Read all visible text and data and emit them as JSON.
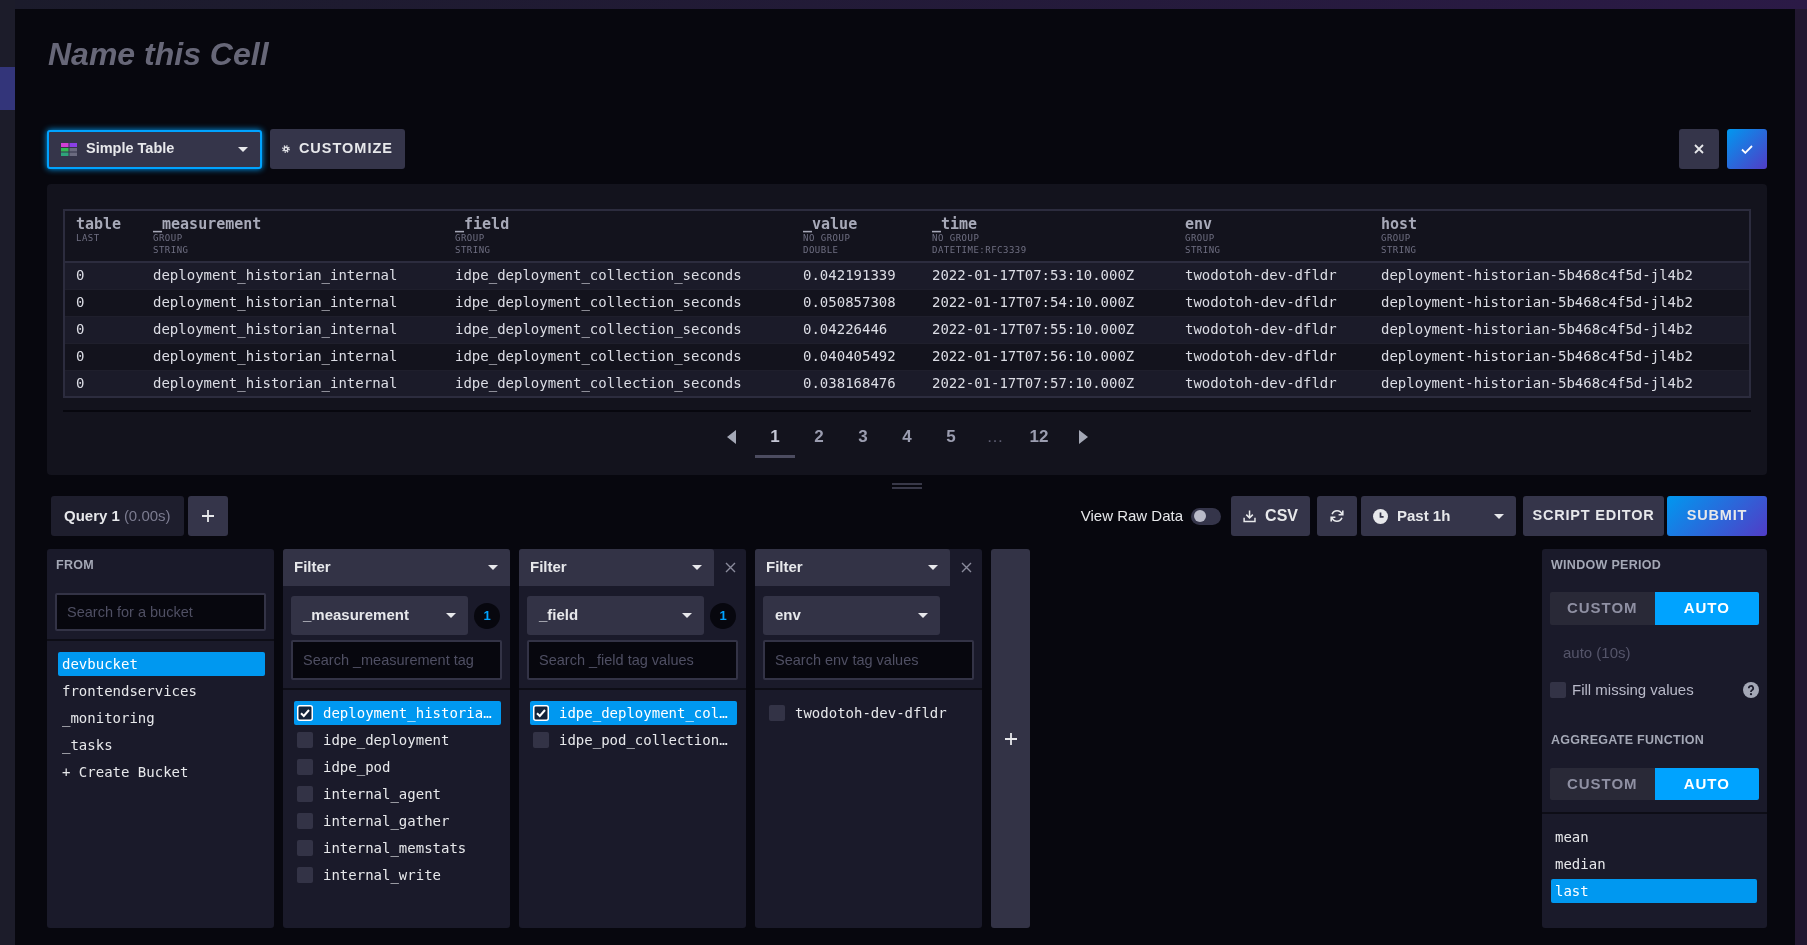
{
  "header": {
    "title": "Name this Cell"
  },
  "toolbar": {
    "visualization": "Simple Table",
    "customize": "CUSTOMIZE"
  },
  "table": {
    "columns": [
      {
        "name": "table",
        "meta": [
          "LAST"
        ]
      },
      {
        "name": "_measurement",
        "meta": [
          "GROUP",
          "STRING"
        ]
      },
      {
        "name": "_field",
        "meta": [
          "GROUP",
          "STRING"
        ]
      },
      {
        "name": "_value",
        "meta": [
          "NO GROUP",
          "DOUBLE"
        ]
      },
      {
        "name": "_time",
        "meta": [
          "NO GROUP",
          "DATETIME:RFC3339"
        ]
      },
      {
        "name": "env",
        "meta": [
          "GROUP",
          "STRING"
        ]
      },
      {
        "name": "host",
        "meta": [
          "GROUP",
          "STRING"
        ]
      }
    ],
    "rows": [
      [
        "0",
        "deployment_historian_internal",
        "idpe_deployment_collection_seconds",
        "0.042191339",
        "2022-01-17T07:53:10.000Z",
        "twodotoh-dev-dfldr",
        "deployment-historian-5b468c4f5d-jl4b2"
      ],
      [
        "0",
        "deployment_historian_internal",
        "idpe_deployment_collection_seconds",
        "0.050857308",
        "2022-01-17T07:54:10.000Z",
        "twodotoh-dev-dfldr",
        "deployment-historian-5b468c4f5d-jl4b2"
      ],
      [
        "0",
        "deployment_historian_internal",
        "idpe_deployment_collection_seconds",
        "0.04226446",
        "2022-01-17T07:55:10.000Z",
        "twodotoh-dev-dfldr",
        "deployment-historian-5b468c4f5d-jl4b2"
      ],
      [
        "0",
        "deployment_historian_internal",
        "idpe_deployment_collection_seconds",
        "0.040405492",
        "2022-01-17T07:56:10.000Z",
        "twodotoh-dev-dfldr",
        "deployment-historian-5b468c4f5d-jl4b2"
      ],
      [
        "0",
        "deployment_historian_internal",
        "idpe_deployment_collection_seconds",
        "0.038168476",
        "2022-01-17T07:57:10.000Z",
        "twodotoh-dev-dfldr",
        "deployment-historian-5b468c4f5d-jl4b2"
      ]
    ]
  },
  "pagination": {
    "pages": [
      {
        "kind": "page",
        "label": "1",
        "selected": true
      },
      {
        "kind": "page",
        "label": "2",
        "selected": false
      },
      {
        "kind": "page",
        "label": "3",
        "selected": false
      },
      {
        "kind": "page",
        "label": "4",
        "selected": false
      },
      {
        "kind": "page",
        "label": "5",
        "selected": false
      },
      {
        "kind": "gap",
        "label": "…",
        "selected": false
      },
      {
        "kind": "page",
        "label": "12",
        "selected": false
      }
    ]
  },
  "query_bar": {
    "tabs": [
      {
        "label": "Query 1",
        "timing": "(0.00s)",
        "selected": true
      }
    ],
    "raw_data": {
      "label": "View Raw Data",
      "on": false
    },
    "csv": "CSV",
    "time_range": "Past 1h",
    "script_editor": "SCRIPT EDITOR",
    "submit": "SUBMIT"
  },
  "builder": {
    "from": {
      "heading": "FROM",
      "placeholder": "Search for a bucket",
      "buckets": [
        {
          "label": "devbucket",
          "selected": true
        },
        {
          "label": "frontendservices",
          "selected": false
        },
        {
          "label": "_monitoring",
          "selected": false
        },
        {
          "label": "_tasks",
          "selected": false
        }
      ],
      "create": "+ Create Bucket"
    },
    "filters": [
      {
        "title": "Filter",
        "removable": false,
        "key": "_measurement",
        "count": "1",
        "placeholder": "Search _measurement tag",
        "values": [
          {
            "label": "deployment_historia…",
            "checked": true
          },
          {
            "label": "idpe_deployment",
            "checked": false
          },
          {
            "label": "idpe_pod",
            "checked": false
          },
          {
            "label": "internal_agent",
            "checked": false
          },
          {
            "label": "internal_gather",
            "checked": false
          },
          {
            "label": "internal_memstats",
            "checked": false
          },
          {
            "label": "internal_write",
            "checked": false
          }
        ]
      },
      {
        "title": "Filter",
        "removable": true,
        "key": "_field",
        "count": "1",
        "placeholder": "Search _field tag values",
        "values": [
          {
            "label": "idpe_deployment_col…",
            "checked": true
          },
          {
            "label": "idpe_pod_collection…",
            "checked": false
          }
        ]
      },
      {
        "title": "Filter",
        "removable": true,
        "key": "env",
        "placeholder": "Search env tag values",
        "values": [
          {
            "label": "twodotoh-dev-dfldr",
            "checked": false
          }
        ]
      }
    ]
  },
  "aggregate_panel": {
    "window_period": {
      "heading": "WINDOW PERIOD",
      "modes": [
        {
          "label": "CUSTOM",
          "selected": false
        },
        {
          "label": "AUTO",
          "selected": true
        }
      ],
      "placeholder": "auto (10s)",
      "fill_missing": {
        "label": "Fill missing values",
        "checked": false
      }
    },
    "aggregate_function": {
      "heading": "AGGREGATE FUNCTION",
      "modes": [
        {
          "label": "CUSTOM",
          "selected": false
        },
        {
          "label": "AUTO",
          "selected": true
        }
      ],
      "functions": [
        {
          "label": "mean",
          "selected": false
        },
        {
          "label": "median",
          "selected": false
        },
        {
          "label": "last",
          "selected": true
        }
      ]
    }
  }
}
